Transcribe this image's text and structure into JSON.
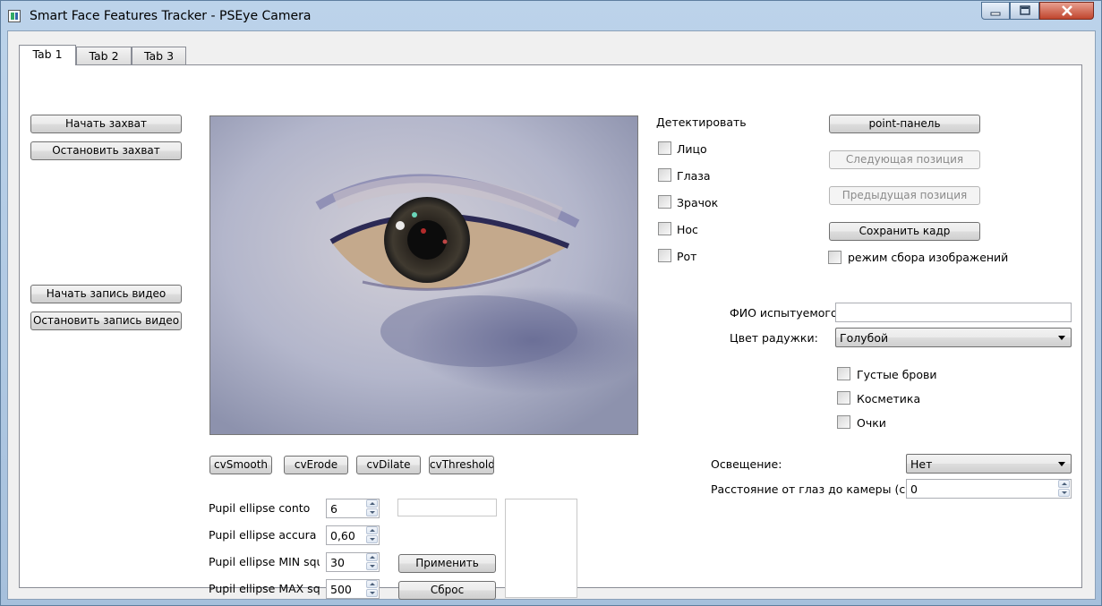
{
  "window": {
    "title": "Smart Face Features Tracker - PSEye Camera"
  },
  "tabs": [
    {
      "label": "Tab 1",
      "active": true
    },
    {
      "label": "Tab 2",
      "active": false
    },
    {
      "label": "Tab 3",
      "active": false
    }
  ],
  "capture": {
    "start_label": "Начать захват",
    "stop_label": "Остановить захват"
  },
  "video": {
    "start_label": "Начать запись видео",
    "stop_label": "Остановить запись видео"
  },
  "camera_view": {
    "content": "eye-closeup-image"
  },
  "filters": {
    "smooth_label": "cvSmooth",
    "erode_label": "cvErode",
    "dilate_label": "cvDilate",
    "threshold_label": "cvThreshold"
  },
  "pupil": {
    "rows": [
      {
        "label": "Pupil ellipse conto",
        "value": "6"
      },
      {
        "label": "Pupil ellipse accura",
        "value": "0,60"
      },
      {
        "label": "Pupil ellipse MIN squa",
        "value": "30"
      },
      {
        "label": "Pupil ellipse MAX squ",
        "value": "500"
      }
    ],
    "apply_label": "Применить",
    "reset_label": "Сброс"
  },
  "detect": {
    "heading": "Детектировать",
    "items": [
      {
        "label": "Лицо",
        "checked": false
      },
      {
        "label": "Глаза",
        "checked": false
      },
      {
        "label": "Зрачок",
        "checked": false
      },
      {
        "label": "Нос",
        "checked": false
      },
      {
        "label": "Рот",
        "checked": false
      }
    ]
  },
  "points": {
    "panel_label": "point-панель",
    "next_label": "Следующая позиция",
    "prev_label": "Предыдущая позиция",
    "save_label": "Сохранить кадр",
    "collect_mode_label": "режим сбора изображений"
  },
  "subject": {
    "name_label": "ФИО испытуемого:",
    "name_value": "",
    "iris_label": "Цвет радужки:",
    "iris_value": "Голубой",
    "traits": [
      {
        "label": "Густые брови",
        "checked": false
      },
      {
        "label": "Косметика",
        "checked": false
      },
      {
        "label": "Очки",
        "checked": false
      }
    ],
    "lighting_label": "Освещение:",
    "lighting_value": "Нет",
    "distance_label": "Расстояние от глаз до камеры (см):",
    "distance_value": "0"
  }
}
